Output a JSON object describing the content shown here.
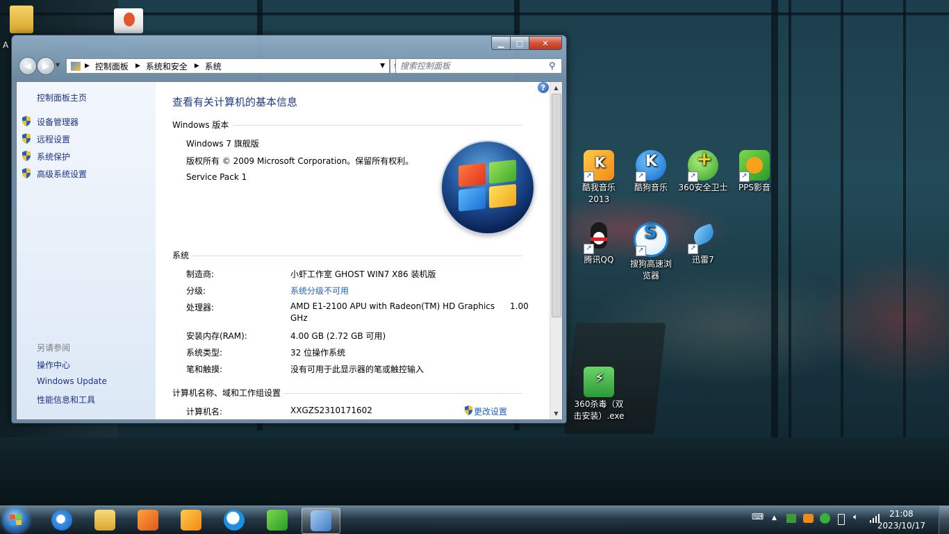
{
  "desktop": {
    "icons": [
      {
        "name": "icon-kuwo",
        "label": "酷我音乐\n2013",
        "color": "#f39a1e"
      },
      {
        "name": "icon-kugou",
        "label": "酷狗音乐",
        "color": "#1b86e0"
      },
      {
        "name": "icon-360safe",
        "label": "360安全卫士",
        "color": "#38b13c"
      },
      {
        "name": "icon-pps",
        "label": "PPS影音",
        "color": "#2ca63a"
      },
      {
        "name": "icon-qq",
        "label": "腾讯QQ",
        "color": "#222222"
      },
      {
        "name": "icon-sogou",
        "label": "搜狗高速浏\n览器",
        "color": "#1b8fe0"
      },
      {
        "name": "icon-xunlei",
        "label": "迅雷7",
        "color": "#2a91dd"
      },
      {
        "name": "icon-360sd",
        "label": "360杀毒（双\n击安装）.exe",
        "color": "#3db04b"
      }
    ],
    "partial_top_left_label": "A"
  },
  "window": {
    "address": {
      "segments": [
        "控制面板",
        "系统和安全",
        "系统"
      ]
    },
    "search_placeholder": "搜索控制面板",
    "left_pane": {
      "home": "控制面板主页",
      "tasks": [
        "设备管理器",
        "远程设置",
        "系统保护",
        "高级系统设置"
      ],
      "see_also_heading": "另请参阅",
      "see_also": [
        "操作中心",
        "Windows Update",
        "性能信息和工具"
      ]
    },
    "main": {
      "help_label": "?",
      "title": "查看有关计算机的基本信息",
      "edition_heading": "Windows 版本",
      "edition": {
        "name": "Windows 7 旗舰版",
        "copyright": "版权所有 © 2009 Microsoft Corporation。保留所有权利。",
        "service_pack": "Service Pack 1"
      },
      "system_heading": "系统",
      "system_rows": [
        {
          "label": "制造商:",
          "value": "小虾工作室 GHOST WIN7 X86 装机版"
        },
        {
          "label": "分级:",
          "value": "系统分级不可用"
        },
        {
          "label": "处理器:",
          "value": "AMD E1-2100 APU with Radeon(TM) HD Graphics",
          "value2": "1.00",
          "value3": "GHz"
        },
        {
          "label": "安装内存(RAM):",
          "value": "4.00 GB (2.72 GB 可用)"
        },
        {
          "label": "系统类型:",
          "value": "32 位操作系统"
        },
        {
          "label": "笔和触摸:",
          "value": "没有可用于此显示器的笔或触控输入"
        }
      ],
      "computer_heading": "计算机名称、域和工作组设置",
      "computer_name_label": "计算机名:",
      "computer_name_value": "XXGZS2310171602",
      "change_settings": "更改设置"
    }
  },
  "taskbar": {
    "clock_time": "21:08",
    "clock_date": "2023/10/17",
    "tray_arrow": "▲"
  },
  "colors": {
    "link": "#2060c0",
    "title": "#1e3b8a",
    "left_link": "#1e3287"
  }
}
